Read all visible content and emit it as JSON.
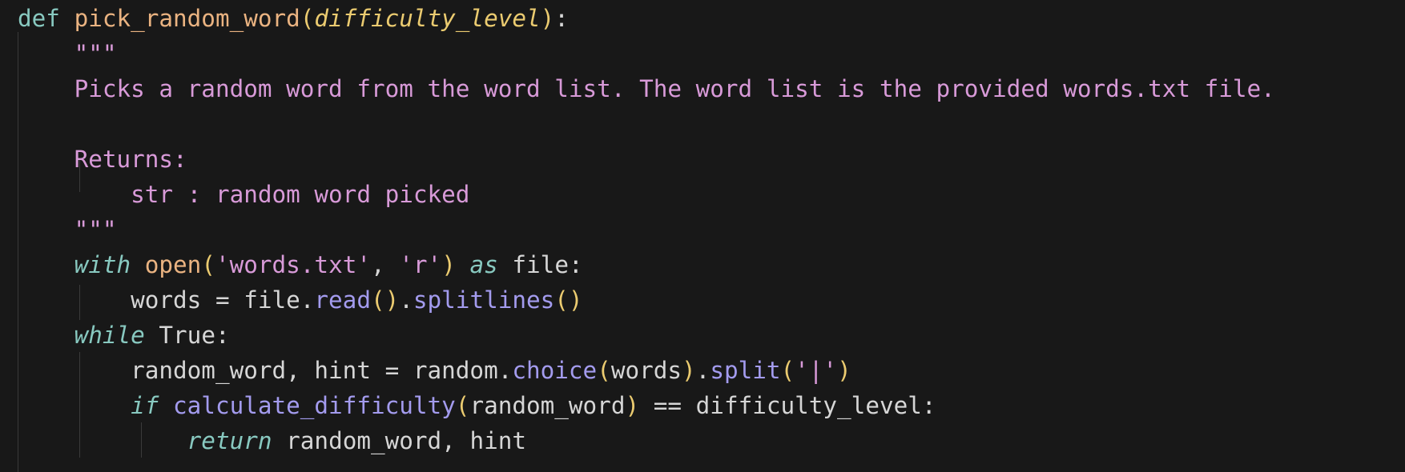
{
  "editor": {
    "language": "python",
    "colors": {
      "background": "#181818",
      "keyword": "#88c9c0",
      "function": "#eab381",
      "parameter": "#ebcb70",
      "string": "#d89ad8",
      "method": "#a39bee",
      "text": "#d6d6d6"
    },
    "lines": [
      [
        {
          "t": "def",
          "c": "kw"
        },
        {
          "t": " ",
          "c": "plain"
        },
        {
          "t": "pick_random_word",
          "c": "fn"
        },
        {
          "t": "(",
          "c": "paren"
        },
        {
          "t": "difficulty_level",
          "c": "param"
        },
        {
          "t": ")",
          "c": "paren"
        },
        {
          "t": ":",
          "c": "plain"
        }
      ],
      [
        {
          "t": "    ",
          "c": "plain"
        },
        {
          "t": "\"\"\"",
          "c": "doc"
        }
      ],
      [
        {
          "t": "    ",
          "c": "plain"
        },
        {
          "t": "Picks a random word from the word list. The word list is the provided words.txt file.",
          "c": "doc"
        }
      ],
      [],
      [
        {
          "t": "    ",
          "c": "plain"
        },
        {
          "t": "Returns:",
          "c": "doc"
        }
      ],
      [
        {
          "t": "        ",
          "c": "plain"
        },
        {
          "t": "str : random word picked",
          "c": "doc"
        }
      ],
      [
        {
          "t": "    ",
          "c": "plain"
        },
        {
          "t": "\"\"\"",
          "c": "doc"
        }
      ],
      [
        {
          "t": "    ",
          "c": "plain"
        },
        {
          "t": "with",
          "c": "ital"
        },
        {
          "t": " ",
          "c": "plain"
        },
        {
          "t": "open",
          "c": "builtin"
        },
        {
          "t": "(",
          "c": "paren"
        },
        {
          "t": "'words.txt'",
          "c": "str"
        },
        {
          "t": ", ",
          "c": "plain"
        },
        {
          "t": "'r'",
          "c": "str"
        },
        {
          "t": ")",
          "c": "paren"
        },
        {
          "t": " ",
          "c": "plain"
        },
        {
          "t": "as",
          "c": "ital"
        },
        {
          "t": " file:",
          "c": "plain"
        }
      ],
      [
        {
          "t": "        ",
          "c": "plain"
        },
        {
          "t": "words = file.",
          "c": "plain"
        },
        {
          "t": "read",
          "c": "method"
        },
        {
          "t": "()",
          "c": "paren"
        },
        {
          "t": ".",
          "c": "plain"
        },
        {
          "t": "splitlines",
          "c": "method"
        },
        {
          "t": "()",
          "c": "paren"
        }
      ],
      [
        {
          "t": "    ",
          "c": "plain"
        },
        {
          "t": "while",
          "c": "ital"
        },
        {
          "t": " True:",
          "c": "plain"
        }
      ],
      [
        {
          "t": "        ",
          "c": "plain"
        },
        {
          "t": "random_word, hint = random.",
          "c": "plain"
        },
        {
          "t": "choice",
          "c": "method"
        },
        {
          "t": "(",
          "c": "paren"
        },
        {
          "t": "words",
          "c": "plain"
        },
        {
          "t": ")",
          "c": "paren"
        },
        {
          "t": ".",
          "c": "plain"
        },
        {
          "t": "split",
          "c": "method"
        },
        {
          "t": "(",
          "c": "paren"
        },
        {
          "t": "'|'",
          "c": "str"
        },
        {
          "t": ")",
          "c": "paren"
        }
      ],
      [
        {
          "t": "        ",
          "c": "plain"
        },
        {
          "t": "if",
          "c": "ital"
        },
        {
          "t": " ",
          "c": "plain"
        },
        {
          "t": "calculate_difficulty",
          "c": "method"
        },
        {
          "t": "(",
          "c": "paren"
        },
        {
          "t": "random_word",
          "c": "plain"
        },
        {
          "t": ")",
          "c": "paren"
        },
        {
          "t": " == difficulty_level:",
          "c": "plain"
        }
      ],
      [
        {
          "t": "            ",
          "c": "plain"
        },
        {
          "t": "return",
          "c": "ital"
        },
        {
          "t": " random_word, hint",
          "c": "plain"
        }
      ]
    ]
  }
}
